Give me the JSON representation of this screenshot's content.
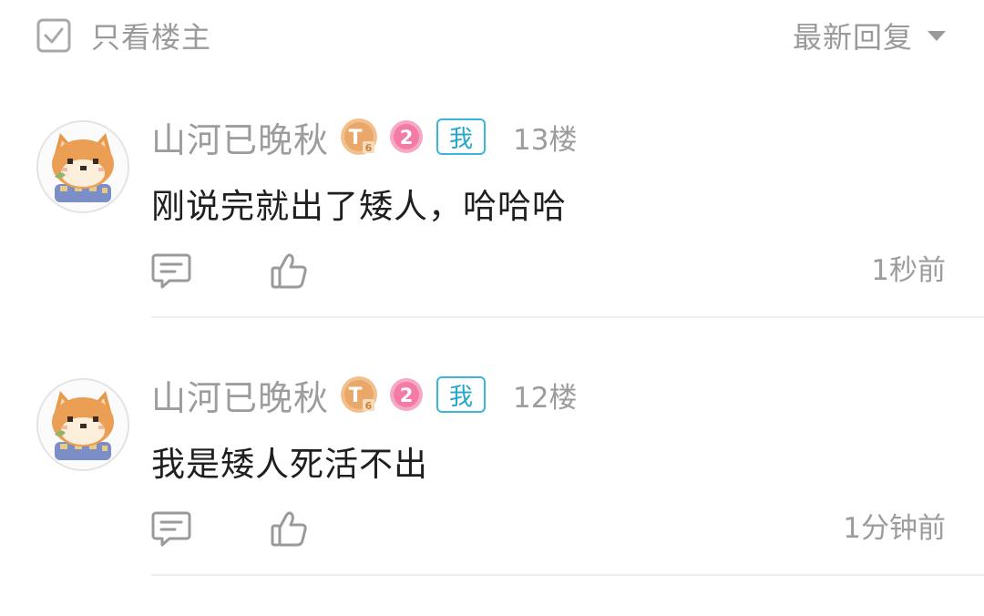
{
  "filter_bar": {
    "only_op_label": "只看楼主",
    "sort_label": "最新回复"
  },
  "comments": [
    {
      "username": "山河已晚秋",
      "badge_t": "T",
      "badge_t_sub": "6",
      "level": "2",
      "me_tag": "我",
      "floor": "13楼",
      "content": "刚说完就出了矮人，哈哈哈",
      "time": "1秒前"
    },
    {
      "username": "山河已晚秋",
      "badge_t": "T",
      "badge_t_sub": "6",
      "level": "2",
      "me_tag": "我",
      "floor": "12楼",
      "content": "我是矮人死活不出",
      "time": "1分钟前"
    }
  ],
  "colors": {
    "muted_text": "#9c9c9c",
    "body_text": "#1f1f1f",
    "me_tag": "#23a7cc",
    "level_badge": "#f47aa7",
    "t_badge": "#e9a86a"
  },
  "icons": {
    "checkbox": "checkbox-icon",
    "sort_caret": "caret-down-icon",
    "reply": "comment-icon",
    "like": "thumbs-up-icon"
  }
}
